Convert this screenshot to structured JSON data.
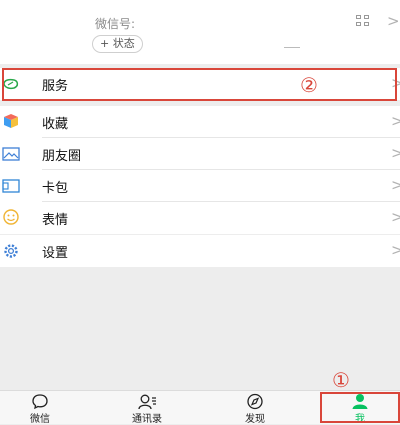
{
  "profile": {
    "wechat_id_label": "微信号:",
    "status_label": "+ 状态"
  },
  "menu": {
    "services": "服务",
    "favorites": "收藏",
    "moments": "朋友圈",
    "cards": "卡包",
    "stickers": "表情",
    "settings": "设置"
  },
  "annotations": {
    "step1": "①",
    "step2": "②"
  },
  "chevron": ">",
  "tabs": {
    "chats": "微信",
    "contacts": "通讯录",
    "discover": "发现",
    "me": "我"
  },
  "colors": {
    "accent": "#07c160",
    "annotation": "#d9463a"
  }
}
